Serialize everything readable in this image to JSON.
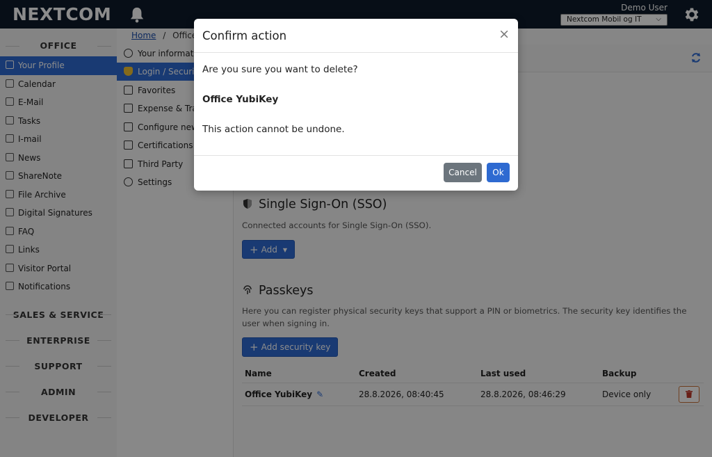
{
  "header": {
    "logo": "NEXTCOM",
    "user_name": "Demo User",
    "company": "Nextcom Mobil og IT"
  },
  "sidebar": {
    "office_title": "OFFICE",
    "items": [
      {
        "label": "Your Profile",
        "icon": "user-icon",
        "active": true
      },
      {
        "label": "Calendar",
        "icon": "calendar-icon"
      },
      {
        "label": "E-Mail",
        "icon": "envelope-icon"
      },
      {
        "label": "Tasks",
        "icon": "tasks-icon"
      },
      {
        "label": "I-mail",
        "icon": "inbox-icon"
      },
      {
        "label": "News",
        "icon": "newspaper-icon"
      },
      {
        "label": "ShareNote",
        "icon": "note-icon"
      },
      {
        "label": "File Archive",
        "icon": "file-archive-icon"
      },
      {
        "label": "Digital Signatures",
        "icon": "signature-icon"
      },
      {
        "label": "FAQ",
        "icon": "faq-icon"
      },
      {
        "label": "Links",
        "icon": "link-icon"
      },
      {
        "label": "Visitor Portal",
        "icon": "portal-icon"
      },
      {
        "label": "Notifications",
        "icon": "bell-icon"
      }
    ],
    "sections": [
      "SALES & SERVICE",
      "ENTERPRISE",
      "SUPPORT",
      "ADMIN",
      "DEVELOPER"
    ]
  },
  "breadcrumb": {
    "home": "Home",
    "separator": "/",
    "current": "Office"
  },
  "submenu": {
    "items": [
      {
        "label": "Your informat",
        "icon": "user-circle-icon"
      },
      {
        "label": "Login / Securi",
        "icon": "shield-icon",
        "active": true
      },
      {
        "label": "Favorites",
        "icon": "star-icon"
      },
      {
        "label": "Expense & Tra",
        "icon": "expense-icon"
      },
      {
        "label": "Configure new",
        "icon": "news-config-icon"
      },
      {
        "label": "Certifications",
        "icon": "graduation-cap-icon"
      },
      {
        "label": "Third Party",
        "icon": "external-link-icon"
      },
      {
        "label": "Settings",
        "icon": "settings-icon"
      }
    ]
  },
  "sso": {
    "title": "Single Sign-On (SSO)",
    "description": "Connected accounts for Single Sign-On (SSO).",
    "add_label": "Add"
  },
  "passkeys": {
    "title": "Passkeys",
    "description": "Here you can register physical security keys that support a PIN or biometrics. The security key identifies the user when signing in.",
    "add_label": "Add security key",
    "columns": [
      "Name",
      "Created",
      "Last used",
      "Backup"
    ],
    "rows": [
      {
        "name": "Office YubiKey",
        "created": "28.8.2026, 08:40:45",
        "last_used": "28.8.2026, 08:46:29",
        "backup": "Device only"
      }
    ]
  },
  "modal": {
    "title": "Confirm action",
    "close": "×",
    "question": "Are you sure you want to delete?",
    "item_name": "Office YubiKey",
    "warning": "This action cannot be undone.",
    "cancel_label": "Cancel",
    "ok_label": "Ok"
  },
  "colors": {
    "header_bg": "#0d1b2a",
    "accent": "#2e6ad1",
    "cancel": "#6c757d"
  }
}
